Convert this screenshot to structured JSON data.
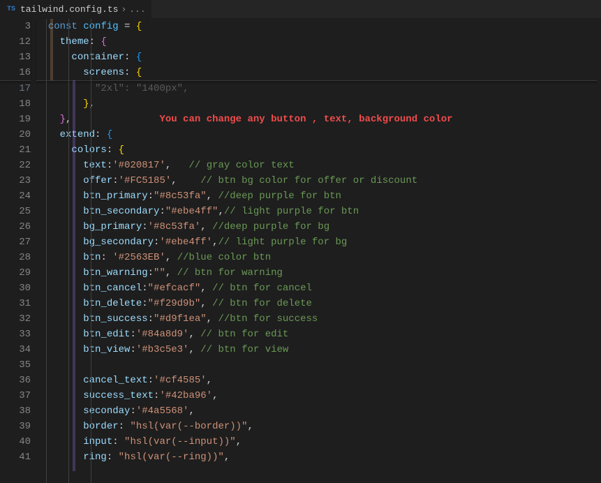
{
  "tab": {
    "filetype_badge": "TS",
    "filename": "tailwind.config.ts",
    "separator": "›",
    "more": "..."
  },
  "gutter": {
    "numbers": [
      "3",
      "12",
      "13",
      "16",
      "17",
      "18",
      "19",
      "20",
      "21",
      "22",
      "23",
      "24",
      "25",
      "26",
      "27",
      "28",
      "29",
      "30",
      "31",
      "32",
      "33",
      "34",
      "35",
      "36",
      "37",
      "38",
      "39",
      "40",
      "41"
    ]
  },
  "annotation": {
    "text": "You can change any button , text, background color"
  },
  "code": {
    "l3_kw": "const",
    "l3_name": "config",
    "l3_eq": " = ",
    "l12_prop": "theme",
    "l13_prop": "container",
    "l16_prop": "screens",
    "l17_key": "\"2xl\"",
    "l17_val": "\"1400px\"",
    "l20_prop": "extend",
    "l21_prop": "colors",
    "l22_key": "text",
    "l22_val": "'#020817'",
    "l22_c": "// gray color text",
    "l23_key": "offer",
    "l23_val": "'#FC5185'",
    "l23_c": "// btn bg color for offer or discount",
    "l24_key": "btn_primary",
    "l24_val": "\"#8c53fa\"",
    "l24_c": "//deep purple for btn",
    "l25_key": "btn_secondary",
    "l25_val": "\"#ebe4ff\"",
    "l25_c": "// light purple for btn",
    "l26_key": "bg_primary",
    "l26_val": "'#8c53fa'",
    "l26_c": "//deep purple for bg",
    "l27_key": "bg_secondary",
    "l27_val": "'#ebe4ff'",
    "l27_c": "// light purple for bg",
    "l28_key": "btn",
    "l28_val": "'#2563EB'",
    "l28_c": "//blue color btn",
    "l29_key": "btn_warning",
    "l29_val": "\"\"",
    "l29_c": "// btn for warning",
    "l30_key": "btn_cancel",
    "l30_val": "\"#efcacf\"",
    "l30_c": "// btn for cancel",
    "l31_key": "btn_delete",
    "l31_val": "\"#f29d9b\"",
    "l31_c": "// btn for delete",
    "l32_key": "btn_success",
    "l32_val": "\"#d9f1ea\"",
    "l32_c": "//btn for success",
    "l33_key": "btn_edit",
    "l33_val": "'#84a8d9'",
    "l33_c": "// btn for edit",
    "l34_key": "btn_view",
    "l34_val": "'#b3c5e3'",
    "l34_c": "// btn for view",
    "l36_key": "cancel_text",
    "l36_val": "'#cf4585'",
    "l37_key": "success_text",
    "l37_val": "'#42ba96'",
    "l38_key": "seconday",
    "l38_val": "'#4a5568'",
    "l39_key": "border",
    "l39_val": "\"hsl(var(--border))\"",
    "l40_key": "input",
    "l40_val": "\"hsl(var(--input))\"",
    "l41_key": "ring",
    "l41_val": "\"hsl(var(--ring))\""
  }
}
